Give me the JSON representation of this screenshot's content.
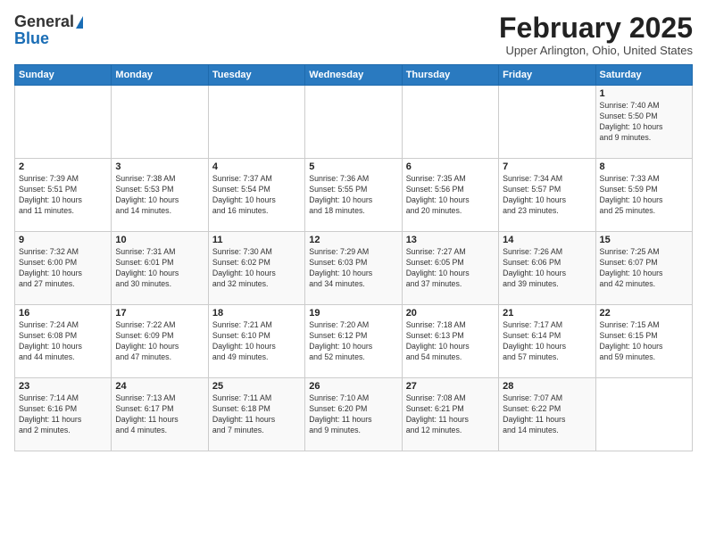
{
  "logo": {
    "line1": "General",
    "line2": "Blue"
  },
  "title": "February 2025",
  "location": "Upper Arlington, Ohio, United States",
  "weekdays": [
    "Sunday",
    "Monday",
    "Tuesday",
    "Wednesday",
    "Thursday",
    "Friday",
    "Saturday"
  ],
  "weeks": [
    [
      {
        "day": "",
        "info": ""
      },
      {
        "day": "",
        "info": ""
      },
      {
        "day": "",
        "info": ""
      },
      {
        "day": "",
        "info": ""
      },
      {
        "day": "",
        "info": ""
      },
      {
        "day": "",
        "info": ""
      },
      {
        "day": "1",
        "info": "Sunrise: 7:40 AM\nSunset: 5:50 PM\nDaylight: 10 hours\nand 9 minutes."
      }
    ],
    [
      {
        "day": "2",
        "info": "Sunrise: 7:39 AM\nSunset: 5:51 PM\nDaylight: 10 hours\nand 11 minutes."
      },
      {
        "day": "3",
        "info": "Sunrise: 7:38 AM\nSunset: 5:53 PM\nDaylight: 10 hours\nand 14 minutes."
      },
      {
        "day": "4",
        "info": "Sunrise: 7:37 AM\nSunset: 5:54 PM\nDaylight: 10 hours\nand 16 minutes."
      },
      {
        "day": "5",
        "info": "Sunrise: 7:36 AM\nSunset: 5:55 PM\nDaylight: 10 hours\nand 18 minutes."
      },
      {
        "day": "6",
        "info": "Sunrise: 7:35 AM\nSunset: 5:56 PM\nDaylight: 10 hours\nand 20 minutes."
      },
      {
        "day": "7",
        "info": "Sunrise: 7:34 AM\nSunset: 5:57 PM\nDaylight: 10 hours\nand 23 minutes."
      },
      {
        "day": "8",
        "info": "Sunrise: 7:33 AM\nSunset: 5:59 PM\nDaylight: 10 hours\nand 25 minutes."
      }
    ],
    [
      {
        "day": "9",
        "info": "Sunrise: 7:32 AM\nSunset: 6:00 PM\nDaylight: 10 hours\nand 27 minutes."
      },
      {
        "day": "10",
        "info": "Sunrise: 7:31 AM\nSunset: 6:01 PM\nDaylight: 10 hours\nand 30 minutes."
      },
      {
        "day": "11",
        "info": "Sunrise: 7:30 AM\nSunset: 6:02 PM\nDaylight: 10 hours\nand 32 minutes."
      },
      {
        "day": "12",
        "info": "Sunrise: 7:29 AM\nSunset: 6:03 PM\nDaylight: 10 hours\nand 34 minutes."
      },
      {
        "day": "13",
        "info": "Sunrise: 7:27 AM\nSunset: 6:05 PM\nDaylight: 10 hours\nand 37 minutes."
      },
      {
        "day": "14",
        "info": "Sunrise: 7:26 AM\nSunset: 6:06 PM\nDaylight: 10 hours\nand 39 minutes."
      },
      {
        "day": "15",
        "info": "Sunrise: 7:25 AM\nSunset: 6:07 PM\nDaylight: 10 hours\nand 42 minutes."
      }
    ],
    [
      {
        "day": "16",
        "info": "Sunrise: 7:24 AM\nSunset: 6:08 PM\nDaylight: 10 hours\nand 44 minutes."
      },
      {
        "day": "17",
        "info": "Sunrise: 7:22 AM\nSunset: 6:09 PM\nDaylight: 10 hours\nand 47 minutes."
      },
      {
        "day": "18",
        "info": "Sunrise: 7:21 AM\nSunset: 6:10 PM\nDaylight: 10 hours\nand 49 minutes."
      },
      {
        "day": "19",
        "info": "Sunrise: 7:20 AM\nSunset: 6:12 PM\nDaylight: 10 hours\nand 52 minutes."
      },
      {
        "day": "20",
        "info": "Sunrise: 7:18 AM\nSunset: 6:13 PM\nDaylight: 10 hours\nand 54 minutes."
      },
      {
        "day": "21",
        "info": "Sunrise: 7:17 AM\nSunset: 6:14 PM\nDaylight: 10 hours\nand 57 minutes."
      },
      {
        "day": "22",
        "info": "Sunrise: 7:15 AM\nSunset: 6:15 PM\nDaylight: 10 hours\nand 59 minutes."
      }
    ],
    [
      {
        "day": "23",
        "info": "Sunrise: 7:14 AM\nSunset: 6:16 PM\nDaylight: 11 hours\nand 2 minutes."
      },
      {
        "day": "24",
        "info": "Sunrise: 7:13 AM\nSunset: 6:17 PM\nDaylight: 11 hours\nand 4 minutes."
      },
      {
        "day": "25",
        "info": "Sunrise: 7:11 AM\nSunset: 6:18 PM\nDaylight: 11 hours\nand 7 minutes."
      },
      {
        "day": "26",
        "info": "Sunrise: 7:10 AM\nSunset: 6:20 PM\nDaylight: 11 hours\nand 9 minutes."
      },
      {
        "day": "27",
        "info": "Sunrise: 7:08 AM\nSunset: 6:21 PM\nDaylight: 11 hours\nand 12 minutes."
      },
      {
        "day": "28",
        "info": "Sunrise: 7:07 AM\nSunset: 6:22 PM\nDaylight: 11 hours\nand 14 minutes."
      },
      {
        "day": "",
        "info": ""
      }
    ]
  ]
}
